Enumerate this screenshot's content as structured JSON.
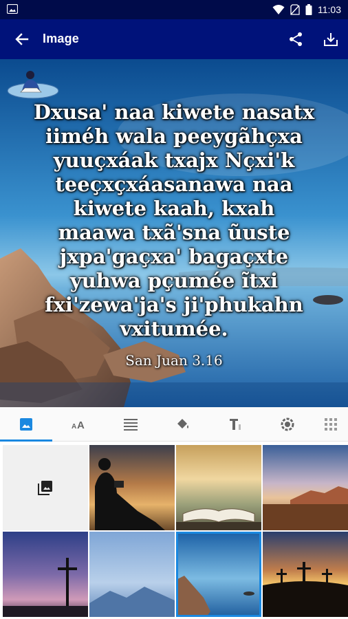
{
  "status_bar": {
    "time": "11:03",
    "icons": [
      "image-notification-icon",
      "wifi-icon",
      "no-sim-icon",
      "battery-icon"
    ]
  },
  "app_bar": {
    "title": "Image",
    "back_icon": "arrow-back-icon",
    "actions": [
      "share-icon",
      "download-icon"
    ]
  },
  "verse": {
    "lines": [
      "Dxusa' naa kiwete nasatx",
      "iiméh wala peeygãhçxa",
      "yuuçxáak txajx Nçxi'k",
      "teeçxçxáasanawa naa",
      "kiwete kaah, kxah",
      "maawa txã'sna ũuste",
      "jxpa'gaçxa' bagaçxte",
      "yuhwa pçumée ĩtxi",
      "fxi'zewa'ja's ji'phukahn",
      "vxitumée."
    ],
    "reference": "San Juan 3.16"
  },
  "tools": [
    {
      "icon": "image-icon",
      "active": true
    },
    {
      "icon": "font-size-icon",
      "active": false
    },
    {
      "icon": "text-align-icon",
      "active": false
    },
    {
      "icon": "fill-color-icon",
      "active": false
    },
    {
      "icon": "text-format-icon",
      "active": false
    },
    {
      "icon": "brightness-icon",
      "active": false
    },
    {
      "icon": "grid-icon",
      "active": false
    }
  ],
  "thumbnails": [
    {
      "name": "gallery",
      "icon": "photo-library-icon"
    },
    {
      "name": "boy-reading-sunset"
    },
    {
      "name": "open-book-lake"
    },
    {
      "name": "desert-sunset"
    },
    {
      "name": "cross-dusk"
    },
    {
      "name": "misty-mountains"
    },
    {
      "name": "rocks-sea",
      "selected": true
    },
    {
      "name": "three-crosses-sunset"
    }
  ],
  "colors": {
    "status_bar": "#000b4a",
    "app_bar": "#00127a",
    "accent": "#1a88e0"
  }
}
